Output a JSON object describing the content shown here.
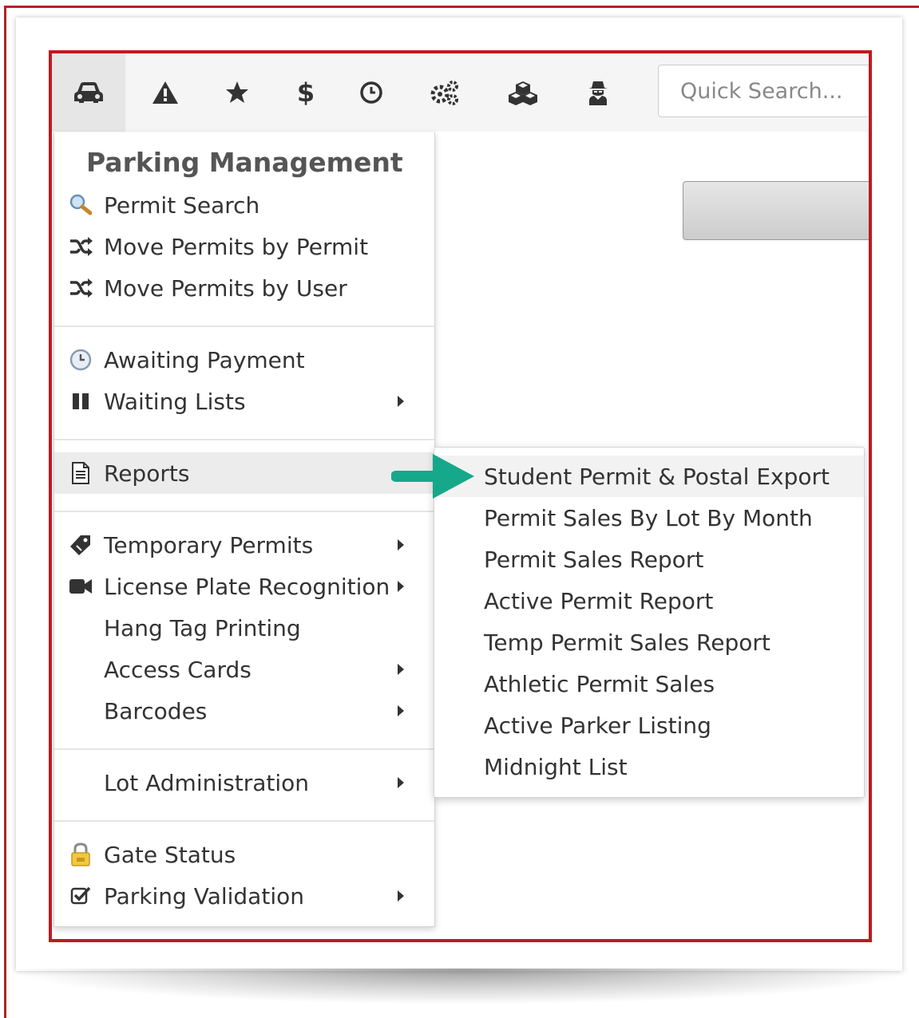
{
  "toolbar": {
    "icons": [
      "car-icon",
      "warning-icon",
      "star-icon",
      "dollar-icon",
      "clock-icon",
      "gears-icon",
      "cubes-icon",
      "user-secret-icon"
    ],
    "search_placeholder": "Quick Search..."
  },
  "menu": {
    "header": "Parking Management",
    "items": [
      {
        "label": "Permit Search",
        "icon": "search-icon"
      },
      {
        "label": "Move Permits by Permit",
        "icon": "shuffle-icon"
      },
      {
        "label": "Move Permits by User",
        "icon": "shuffle-icon"
      },
      {
        "label": "Awaiting Payment",
        "icon": "clock-icon"
      },
      {
        "label": "Waiting Lists",
        "icon": "pause-icon"
      },
      {
        "label": "Reports",
        "icon": "document-icon"
      },
      {
        "label": "Temporary Permits",
        "icon": "tag-icon"
      },
      {
        "label": "License Plate Recognition",
        "icon": "video-camera-icon"
      },
      {
        "label": "Hang Tag Printing"
      },
      {
        "label": "Access Cards"
      },
      {
        "label": "Barcodes"
      },
      {
        "label": "Lot Administration"
      },
      {
        "label": "Gate Status",
        "icon": "lock-icon"
      },
      {
        "label": "Parking Validation",
        "icon": "check-square-icon"
      }
    ]
  },
  "reports_submenu": {
    "items": [
      "Student Permit & Postal Export",
      "Permit Sales By Lot By Month",
      "Permit Sales Report",
      "Active Permit Report",
      "Temp Permit Sales Report",
      "Athletic Permit Sales",
      "Active Parker Listing",
      "Midnight List"
    ]
  },
  "colors": {
    "highlight_border": "#bd1b1f",
    "arrow": "#16a88a",
    "toolbar_bg": "#f5f5f5"
  }
}
